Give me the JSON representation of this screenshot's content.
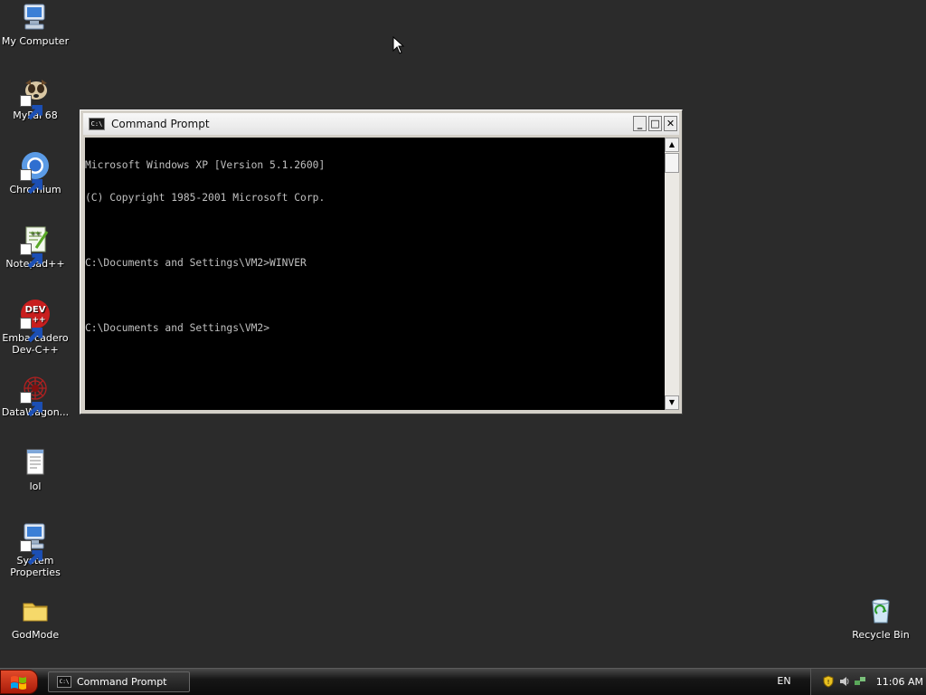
{
  "desktop": {
    "icons": [
      {
        "label_lines": [
          "My Computer"
        ],
        "icon": "my-computer-icon"
      },
      {
        "label_lines": [
          "MyPal 68"
        ],
        "icon": "mypal-browser-icon"
      },
      {
        "label_lines": [
          "Chromium"
        ],
        "icon": "chromium-icon"
      },
      {
        "label_lines": [
          "Notepad++"
        ],
        "icon": "notepad-plus-plus-icon"
      },
      {
        "label_lines": [
          "Embarcadero",
          "Dev-C++"
        ],
        "icon": "dev-cpp-icon",
        "badge": "DEV",
        "badge_sub": "++"
      },
      {
        "label_lines": [
          "DataWagon..."
        ],
        "icon": "datawagon-icon"
      },
      {
        "label_lines": [
          "lol"
        ],
        "icon": "text-document-icon"
      },
      {
        "label_lines": [
          "System",
          "Properties"
        ],
        "icon": "system-properties-icon"
      },
      {
        "label_lines": [
          "GodMode"
        ],
        "icon": "folder-icon"
      },
      {
        "label_lines": [
          "Recycle Bin"
        ],
        "icon": "recycle-bin-icon"
      }
    ]
  },
  "window": {
    "title": "Command Prompt",
    "icon_text": "C:\\",
    "buttons": {
      "minimize": "_",
      "maximize": "□",
      "close": "✕"
    },
    "console_lines": [
      "Microsoft Windows XP [Version 5.1.2600]",
      "(C) Copyright 1985-2001 Microsoft Corp.",
      "",
      "C:\\Documents and Settings\\VM2>WINVER",
      "",
      "C:\\Documents and Settings\\VM2>"
    ],
    "scroll_up": "▲",
    "scroll_down": "▼"
  },
  "taskbar": {
    "task_label": "Command Prompt",
    "task_icon_text": "C:\\",
    "language": "EN",
    "clock": "11:06 AM"
  },
  "colors": {
    "desktop": "#2b2b2b",
    "console_bg": "#000000",
    "console_fg": "#c0c0c0",
    "start_button": "#c8301a"
  }
}
